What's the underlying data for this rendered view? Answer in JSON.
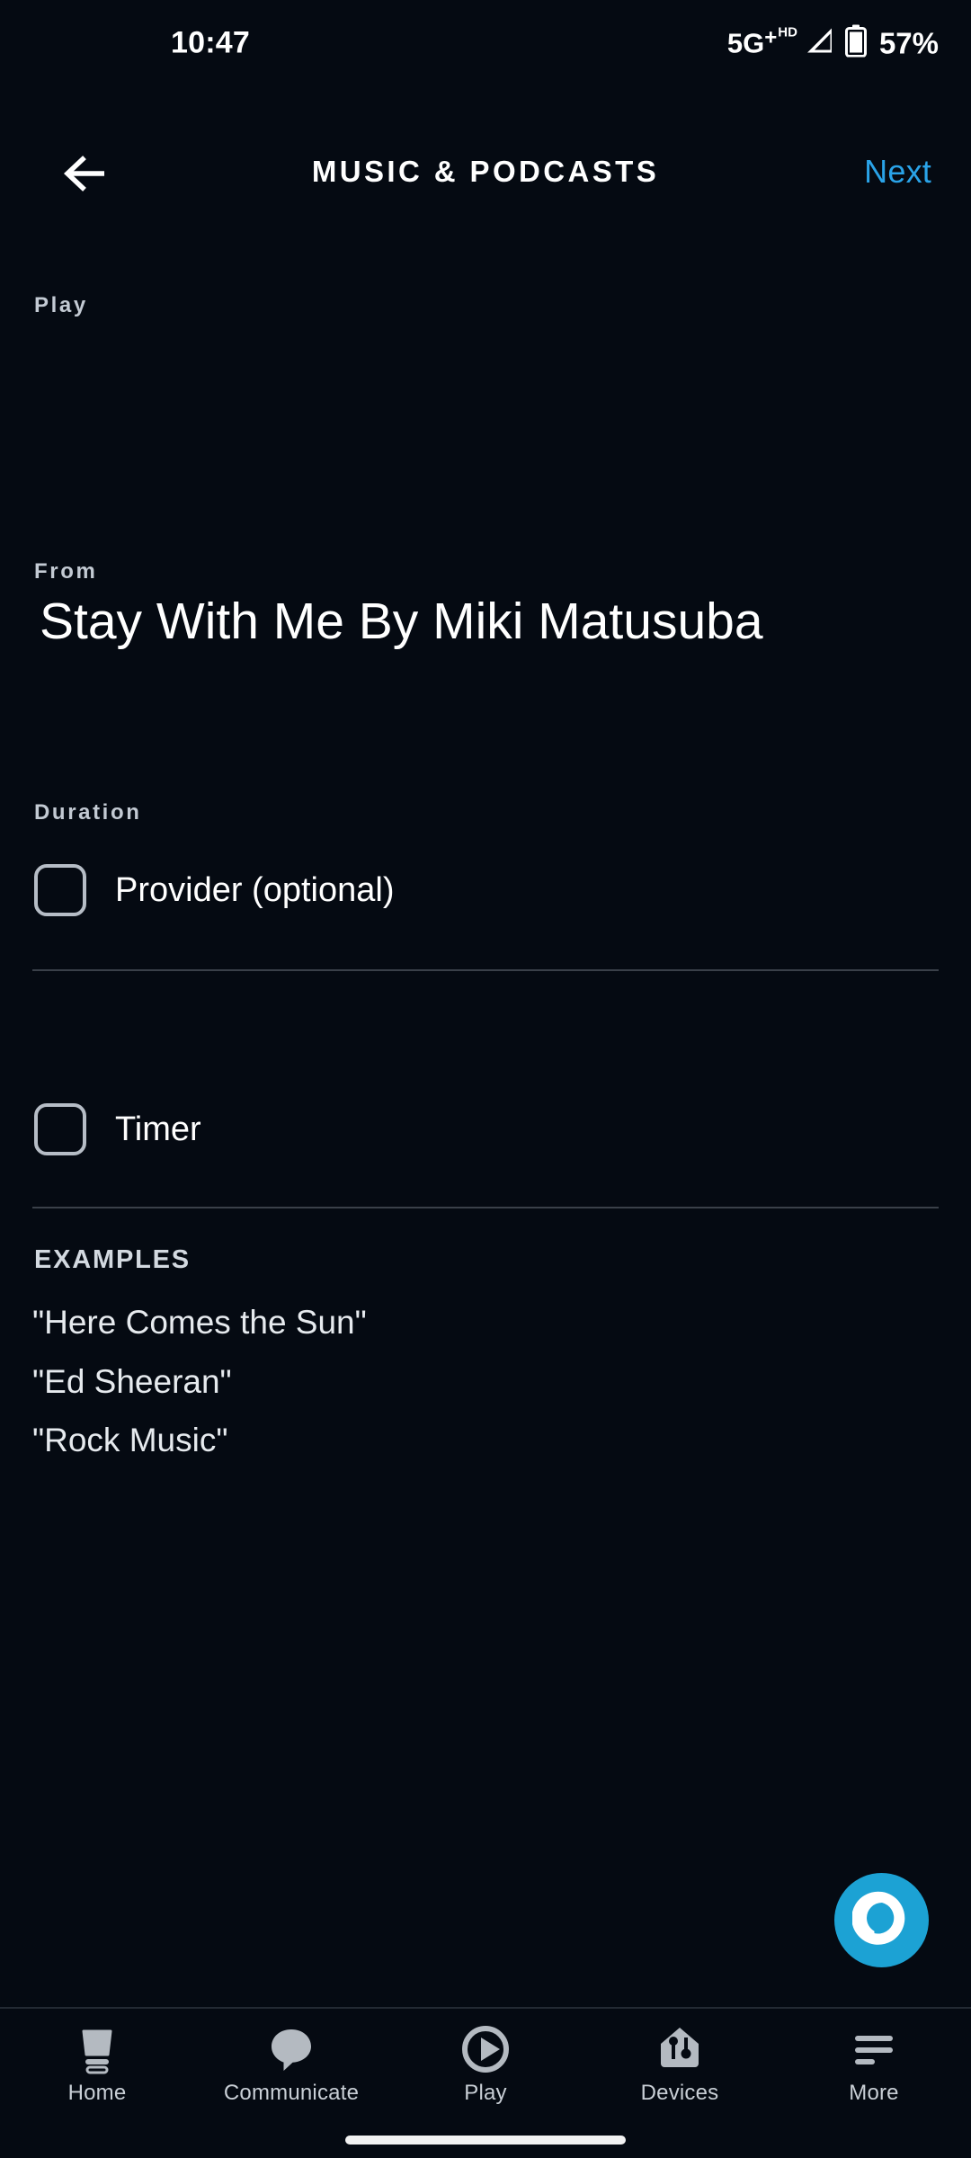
{
  "status_bar": {
    "time": "10:47",
    "network_label": "5G",
    "network_superscript_plus": "+",
    "network_hd": "HD",
    "signal_icon": "signal-bars-icon",
    "battery_icon": "battery-icon",
    "battery_percent": "57%"
  },
  "app_bar": {
    "back_icon": "back-arrow-icon",
    "title": "MUSIC & PODCASTS",
    "next_label": "Next",
    "next_color": "#2aa3e8"
  },
  "form": {
    "play": {
      "label": "Play",
      "value_prefix": "Stay With Me By Miki ",
      "value_misspelled": "Matusuba",
      "value_full": "Stay With Me By Miki Matusuba",
      "spellcheck_underline_color": "#e8493f"
    },
    "from": {
      "label": "From",
      "checkbox_label": "Provider (optional)",
      "checked": "false"
    },
    "duration": {
      "label": "Duration",
      "checkbox_label": "Timer",
      "checked": "false"
    }
  },
  "examples": {
    "heading": "EXAMPLES",
    "items": [
      "\"Here Comes the Sun\"",
      "\"Ed Sheeran\"",
      "\"Rock Music\""
    ]
  },
  "alexa_button": {
    "icon": "alexa-ring-icon",
    "color": "#1ca2d4"
  },
  "bottom_nav": {
    "items": [
      {
        "label": "Home",
        "icon": "echo-device-icon"
      },
      {
        "label": "Communicate",
        "icon": "speech-bubble-icon"
      },
      {
        "label": "Play",
        "icon": "play-circle-icon"
      },
      {
        "label": "Devices",
        "icon": "home-devices-icon"
      },
      {
        "label": "More",
        "icon": "hamburger-menu-icon"
      }
    ]
  }
}
